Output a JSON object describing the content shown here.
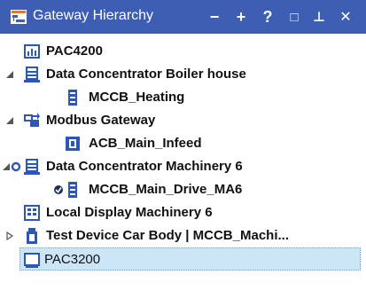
{
  "title_bar": {
    "title": "Gateway Hierarchy",
    "buttons": [
      "−",
      "+",
      "?",
      "□",
      "⊥",
      "✕"
    ]
  },
  "tree": [
    {
      "label": "PAC4200",
      "icon": "power-meter-icon",
      "level": 0,
      "expander": "none",
      "selected": false
    },
    {
      "label": "Data Concentrator Boiler house",
      "icon": "data-concentrator-icon",
      "level": 0,
      "expander": "expanded",
      "selected": false
    },
    {
      "label": "MCCB_Heating",
      "icon": "mccb-breaker-icon",
      "level": 1,
      "expander": "none",
      "selected": false
    },
    {
      "label": "Modbus Gateway",
      "icon": "modbus-gateway-icon",
      "level": 0,
      "expander": "expanded",
      "selected": false
    },
    {
      "label": "ACB_Main_Infeed",
      "icon": "acb-breaker-icon",
      "level": 1,
      "expander": "none",
      "selected": false
    },
    {
      "label": "Data Concentrator Machinery 6",
      "icon": "data-concentrator-icon",
      "level": 0,
      "expander": "expanded",
      "selected": false
    },
    {
      "label": "MCCB_Main_Drive_MA6",
      "icon": "mccb-breaker-icon",
      "level": 1,
      "expander": "none",
      "selected": false
    },
    {
      "label": "Local Display Machinery 6",
      "icon": "local-display-icon",
      "level": 0,
      "expander": "none",
      "selected": false
    },
    {
      "label": "Test Device Car Body | MCCB_Machi...",
      "icon": "test-device-icon",
      "level": 0,
      "expander": "collapsed",
      "selected": false
    },
    {
      "label": "PAC3200",
      "icon": "monitor-device-icon",
      "level": 0,
      "expander": "none",
      "selected": true
    }
  ],
  "colors": {
    "titlebar": "#3d5eb3",
    "selection": "#cce6f8",
    "icon_blue": "#2e55b8"
  }
}
